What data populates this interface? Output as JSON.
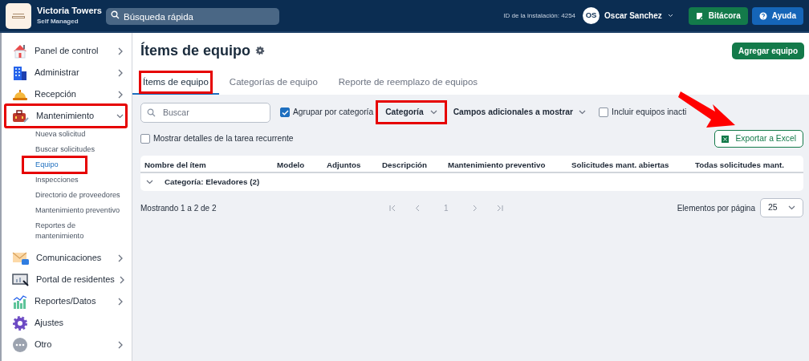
{
  "header": {
    "org_name": "Victoria Towers",
    "org_subtitle": "Self Managed",
    "search": {
      "placeholder": "Búsqueda rápida"
    },
    "installation_id": "ID de la instalación: 4254",
    "user": {
      "initials": "OS",
      "name": "Oscar Sanchez"
    },
    "buttons": [
      {
        "label": "Bitácora",
        "kind": "log"
      },
      {
        "label": "Ayuda",
        "kind": "help"
      }
    ]
  },
  "sidebar": {
    "items": [
      {
        "label": "Panel de control",
        "expanded": false,
        "highlighted": false
      },
      {
        "label": "Administrar",
        "expanded": false,
        "highlighted": false
      },
      {
        "label": "Recepción",
        "expanded": false,
        "highlighted": false
      },
      {
        "label": "Mantenimiento",
        "expanded": true,
        "highlighted": true,
        "children": [
          {
            "label": "Nueva solicitud",
            "selected": false,
            "highlighted": false
          },
          {
            "label": "Buscar solicitudes",
            "selected": false,
            "highlighted": false
          },
          {
            "label": "Equipo",
            "selected": true,
            "highlighted": true
          },
          {
            "label": "Inspecciones",
            "selected": false,
            "highlighted": false
          },
          {
            "label": "Directorio de proveedores",
            "selected": false,
            "highlighted": false
          },
          {
            "label": "Mantenimiento preventivo",
            "selected": false,
            "highlighted": false
          },
          {
            "label": "Reportes de mantenimiento",
            "selected": false,
            "highlighted": false
          }
        ]
      },
      {
        "label": "Comunicaciones",
        "expanded": false,
        "highlighted": false
      },
      {
        "label": "Portal de residentes",
        "expanded": false,
        "highlighted": false
      },
      {
        "label": "Reportes/Datos",
        "expanded": false,
        "highlighted": false
      },
      {
        "label": "Ajustes",
        "highlighted": false
      },
      {
        "label": "Otro",
        "expanded": false,
        "highlighted": false
      }
    ]
  },
  "page": {
    "title": "Ítems de equipo",
    "primary_button": "Agregar equipo",
    "tabs": [
      {
        "label": "Ítems de equipo",
        "selected": true,
        "highlighted": true
      },
      {
        "label": "Categorías de equipo",
        "selected": false,
        "highlighted": false
      },
      {
        "label": "Reporte de reemplazo de equipos",
        "selected": false,
        "highlighted": false
      }
    ],
    "toolbar": {
      "search": {
        "placeholder": "Buscar"
      },
      "group_by_category": {
        "label": "Agrupar por categoría",
        "checked": true
      },
      "category_dropdown": {
        "label": "Categoría",
        "highlighted": true
      },
      "extra_fields_dropdown": {
        "label": "Campos adicionales a mostrar"
      },
      "include_inactive": {
        "label": "Incluir equipos inacti",
        "checked": false
      },
      "show_recurring": {
        "label": "Mostrar detalles de la tarea recurrente",
        "checked": false
      },
      "export_button": "Exportar a Excel"
    },
    "callout_arrow": true,
    "table": {
      "columns": [
        "Nombre del ítem",
        "Modelo",
        "Adjuntos",
        "Descripción",
        "Mantenimiento preventivo",
        "Solicitudes mant. abiertas",
        "Todas solicitudes mant."
      ],
      "group_row": "Categoría: Elevadores (2)"
    },
    "pagination": {
      "summary": "Mostrando 1 a 2 de 2",
      "current_page": "1",
      "per_page_label": "Elementos por página",
      "per_page": "25"
    }
  }
}
